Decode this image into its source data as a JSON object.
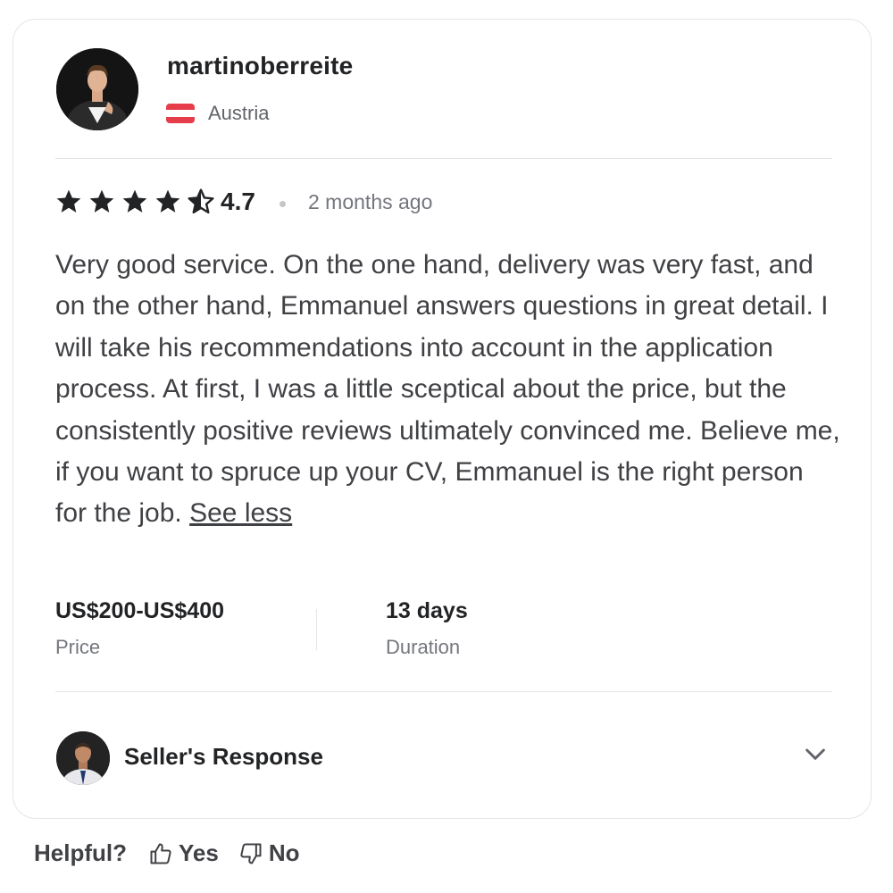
{
  "reviewer": {
    "username": "martinoberreite",
    "country": "Austria",
    "avatar_icon": "reviewer-avatar-photo",
    "flag_colors": [
      "#e53e4a",
      "#ffffff",
      "#e53e4a"
    ]
  },
  "review": {
    "stars": 4.5,
    "rating": "4.7",
    "time_ago": "2 months ago",
    "text": "Very good service. On the one hand, delivery was very fast, and on the other hand, Emmanuel answers questions in great detail. I will take his recommendations into account in the application process. At first, I was a little sceptical about the price, but the consistently positive reviews ultimately convinced me. Believe me, if you want to spruce up your CV, Emmanuel is the right person for the job.",
    "toggle_label": "See less"
  },
  "meta": {
    "price_value": "US$200-US$400",
    "price_label": "Price",
    "duration_value": "13 days",
    "duration_label": "Duration"
  },
  "seller_response": {
    "label": "Seller's Response",
    "avatar_icon": "seller-avatar-photo",
    "toggle_icon": "chevron-down-icon"
  },
  "helpful": {
    "question": "Helpful?",
    "yes_label": "Yes",
    "no_label": "No",
    "yes_icon": "thumbs-up-icon",
    "no_icon": "thumbs-down-icon"
  },
  "colors": {
    "text_primary": "#222325",
    "text_body": "#404145",
    "text_muted": "#74767e",
    "border": "#e4e5e7"
  }
}
